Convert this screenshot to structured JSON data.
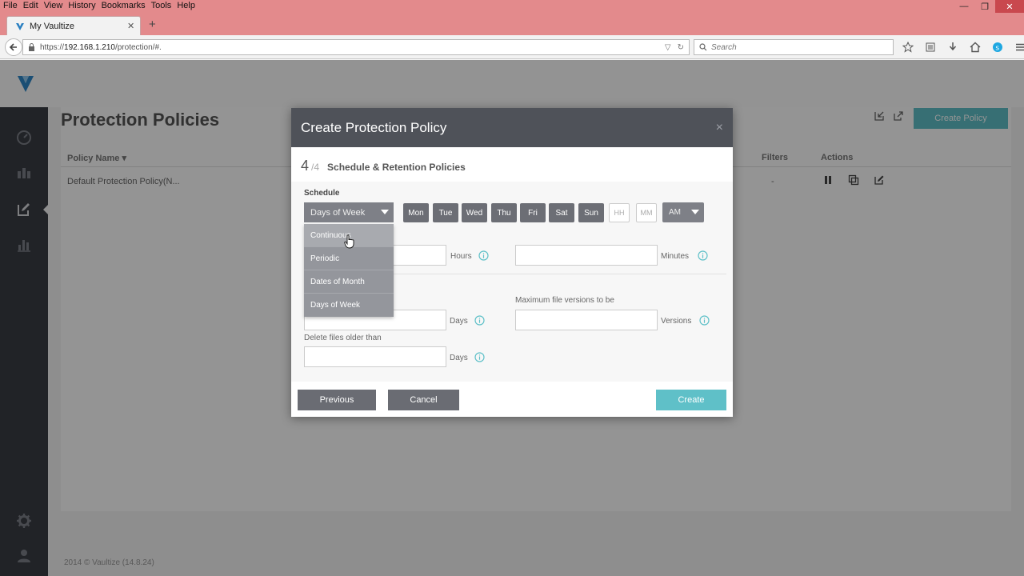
{
  "browser": {
    "menus": [
      "File",
      "Edit",
      "View",
      "History",
      "Bookmarks",
      "Tools",
      "Help"
    ],
    "tab_title": "My Vaultize",
    "url_prefix": "https://",
    "url_host": "192.168.1.210",
    "url_path": "/protection/#.",
    "search_placeholder": "Search"
  },
  "page": {
    "title": "Protection Policies",
    "create_policy_label": "Create Policy",
    "columns": {
      "policy_name": "Policy Name ▾",
      "filters": "Filters",
      "actions": "Actions"
    },
    "rows": [
      {
        "name": "Default Protection Policy(N...",
        "filters": "-"
      }
    ],
    "footer": "2014 © Vaultize (14.8.24)"
  },
  "modal": {
    "title": "Create Protection Policy",
    "close_glyph": "×",
    "step_current": "4",
    "step_total": "/4",
    "step_label": "Schedule & Retention Policies",
    "schedule_label": "Schedule",
    "schedule_selected": "Days of Week",
    "schedule_options": [
      "Continuous",
      "Periodic",
      "Dates of Month",
      "Days of Week"
    ],
    "days": [
      "Mon",
      "Tue",
      "Wed",
      "Thu",
      "Fri",
      "Sat",
      "Sun"
    ],
    "hour_placeholder": "HH",
    "minute_placeholder": "MM",
    "ampm": "AM",
    "hours_unit": "Hours",
    "minutes_unit": "Minutes",
    "max_versions_label": "Maximum file versions to be",
    "days_unit": "Days",
    "versions_unit": "Versions",
    "delete_older_label": "Delete files older than",
    "previous_label": "Previous",
    "cancel_label": "Cancel",
    "create_label": "Create"
  },
  "colors": {
    "accent": "#5fc0c8",
    "sidebar": "#3a3d44",
    "modal_header": "#4f5259"
  }
}
